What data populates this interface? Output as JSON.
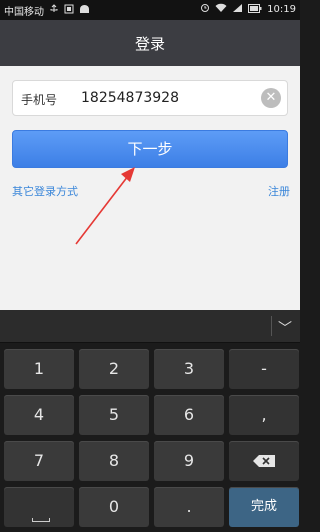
{
  "status_bar": {
    "carrier": "中国移动",
    "time": "10:19"
  },
  "header": {
    "title": "登录"
  },
  "login_form": {
    "phone_label": "手机号",
    "phone_value": "18254873928",
    "next_button": "下一步",
    "other_login_link": "其它登录方式",
    "register_link": "注册"
  },
  "keyboard": {
    "row1": [
      "1",
      "2",
      "3",
      "-"
    ],
    "row2": [
      "4",
      "5",
      "6",
      ","
    ],
    "row3": [
      "7",
      "8",
      "9"
    ],
    "row4_zero": "0",
    "row4_dot": ".",
    "done_label": "完成"
  },
  "colors": {
    "accent": "#4a8ff0",
    "header_bg": "#3c3d42",
    "annotation_arrow": "#e53935"
  }
}
